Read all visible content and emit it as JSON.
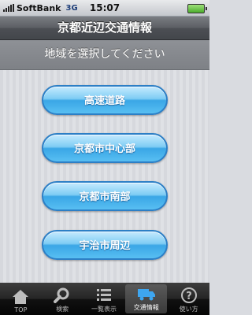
{
  "status": {
    "carrier": "SoftBank",
    "network": "3G",
    "time": "15:07"
  },
  "header": {
    "title": "京都近辺交通情報"
  },
  "subheader": {
    "title": "地域を選択してください"
  },
  "regions": [
    "高速道路",
    "京都市中心部",
    "京都市南部",
    "宇治市周辺"
  ],
  "tabs": [
    {
      "label": "TOP",
      "icon": "home-icon"
    },
    {
      "label": "検索",
      "icon": "search-icon"
    },
    {
      "label": "一覧表示",
      "icon": "list-icon"
    },
    {
      "label": "交通情報",
      "icon": "truck-icon",
      "active": true
    },
    {
      "label": "使い方",
      "icon": "help-icon"
    }
  ]
}
